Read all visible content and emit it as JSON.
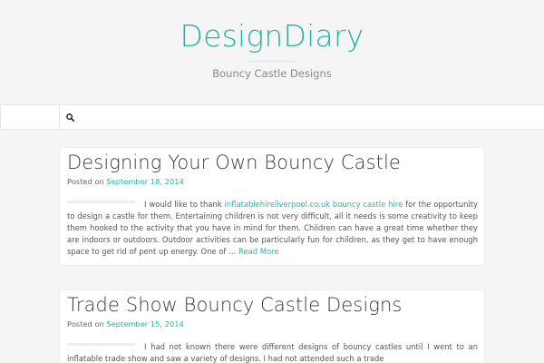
{
  "site": {
    "title": "DesignDiary",
    "description": "Bouncy Castle Designs"
  },
  "nav": {
    "search_icon": "search-icon"
  },
  "posts": [
    {
      "title": "Designing Your Own Bouncy Castle",
      "posted_on": "Posted on",
      "date": "September 18, 2014",
      "excerpt_before": "I would like to thank ",
      "link_text": "inflatablehireliverpool.co.uk bouncy castle hire",
      "excerpt_after": " for the opportunity to design a castle for them. Entertaining children is not very difficult, all it needs is some creativity to keep them hooked to the activity that you have in mind for them. Children can have a great time whether they are indoors or outdoors. Outdoor activities can be particularly fun for children, as they get to have enough space to get rid of pent up energy. One of … ",
      "read_more": "Read More"
    },
    {
      "title": "Trade Show Bouncy Castle Designs",
      "posted_on": "Posted on",
      "date": "September 15, 2014",
      "excerpt": "I had not known there were different designs of bouncy castles until I went to an inflatable trade show and saw a variety of designs. I had not attended such a trade"
    }
  ],
  "colors": {
    "accent": "#26b5a0",
    "background": "#f5f5f5"
  }
}
